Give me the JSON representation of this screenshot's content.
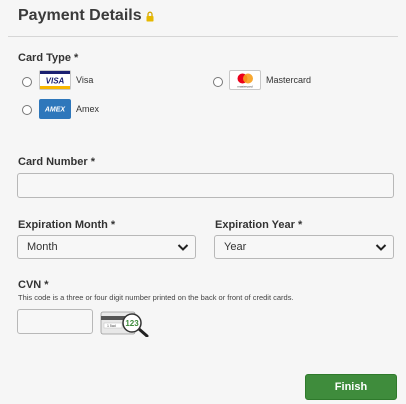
{
  "page": {
    "title": "Payment Details",
    "lock_icon": "lock-icon"
  },
  "card_type": {
    "label": "Card Type",
    "required_mark": "*",
    "options": [
      {
        "name": "Visa",
        "logo_text": "VISA",
        "selected": false
      },
      {
        "name": "Mastercard",
        "logo_text": "mastercard",
        "selected": false
      },
      {
        "name": "Amex",
        "logo_text": "AMEX",
        "selected": false
      }
    ]
  },
  "card_number": {
    "label": "Card Number",
    "required_mark": "*",
    "value": ""
  },
  "expiration_month": {
    "label": "Expiration Month",
    "required_mark": "*",
    "selected": "Month"
  },
  "expiration_year": {
    "label": "Expiration Year",
    "required_mark": "*",
    "selected": "Year"
  },
  "cvn": {
    "label": "CVN",
    "required_mark": "*",
    "hint": "This code is a three or four digit number printed on the back or front of credit cards.",
    "value": "",
    "card_sample_text": "123",
    "card_small_text": "1 5ad"
  },
  "actions": {
    "finish_label": "Finish"
  },
  "colors": {
    "accent_green": "#3f8c3c",
    "lock_gold": "#e6b800"
  }
}
